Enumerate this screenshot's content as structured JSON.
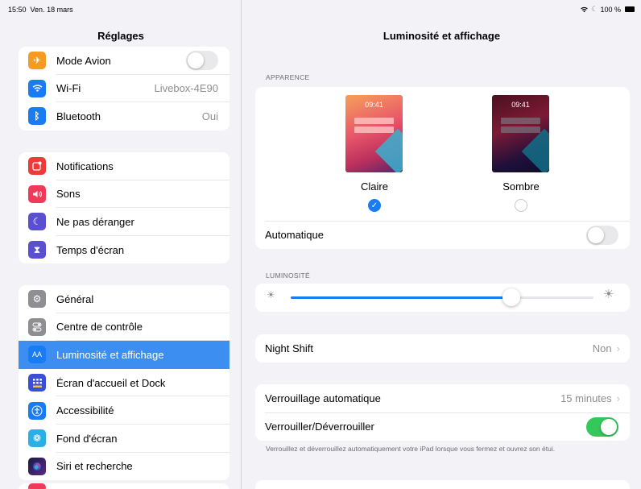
{
  "status_bar": {
    "time": "15:50",
    "date": "Ven. 18 mars",
    "battery": "100 %",
    "wifi_icon": "wifi-icon"
  },
  "sidebar": {
    "title": "Réglages",
    "groups": [
      [
        {
          "label": "Mode Avion",
          "icon": "airplane-icon",
          "icon_color": "#f59a23",
          "toggle": false
        },
        {
          "label": "Wi-Fi",
          "icon": "wifi-icon",
          "icon_color": "#1a7cf4",
          "value": "Livebox-4E90"
        },
        {
          "label": "Bluetooth",
          "icon": "bluetooth-icon",
          "icon_color": "#1a7cf4",
          "value": "Oui"
        }
      ],
      [
        {
          "label": "Notifications",
          "icon": "notifications-icon",
          "icon_color": "#f03a3a"
        },
        {
          "label": "Sons",
          "icon": "speaker-icon",
          "icon_color": "#f03a5a"
        },
        {
          "label": "Ne pas déranger",
          "icon": "moon-icon",
          "icon_color": "#5a4fd0"
        },
        {
          "label": "Temps d'écran",
          "icon": "hourglass-icon",
          "icon_color": "#5a4fd0"
        }
      ],
      [
        {
          "label": "Général",
          "icon": "gear-icon",
          "icon_color": "#8e8e93"
        },
        {
          "label": "Centre de contrôle",
          "icon": "toggles-icon",
          "icon_color": "#8e8e93"
        },
        {
          "label": "Luminosité et affichage",
          "icon": "text-size-icon",
          "icon_color": "#1a7cf4",
          "selected": true
        },
        {
          "label": "Écran d'accueil et Dock",
          "icon": "home-grid-icon",
          "icon_color": "#3a4fd6"
        },
        {
          "label": "Accessibilité",
          "icon": "accessibility-icon",
          "icon_color": "#1a7cf4"
        },
        {
          "label": "Fond d'écran",
          "icon": "wallpaper-icon",
          "icon_color": "#2ab0e6"
        },
        {
          "label": "Siri et recherche",
          "icon": "siri-icon",
          "icon_color": "#222"
        }
      ]
    ]
  },
  "main": {
    "title": "Luminosité et affichage",
    "appearance": {
      "header": "APPARENCE",
      "preview_time": "09:41",
      "light_label": "Claire",
      "dark_label": "Sombre",
      "light_selected": true,
      "automatic_label": "Automatique",
      "automatic_on": false
    },
    "brightness": {
      "header": "LUMINOSITÉ",
      "level": 0.73
    },
    "night_shift": {
      "label": "Night Shift",
      "value": "Non"
    },
    "auto_lock": {
      "label": "Verrouillage automatique",
      "value": "15 minutes"
    },
    "lock_unlock": {
      "label": "Verrouiller/Déverrouiller",
      "on": true
    },
    "footnote": "Verrouillez et déverrouillez automatiquement votre iPad lorsque vous fermez et ouvrez son étui."
  }
}
